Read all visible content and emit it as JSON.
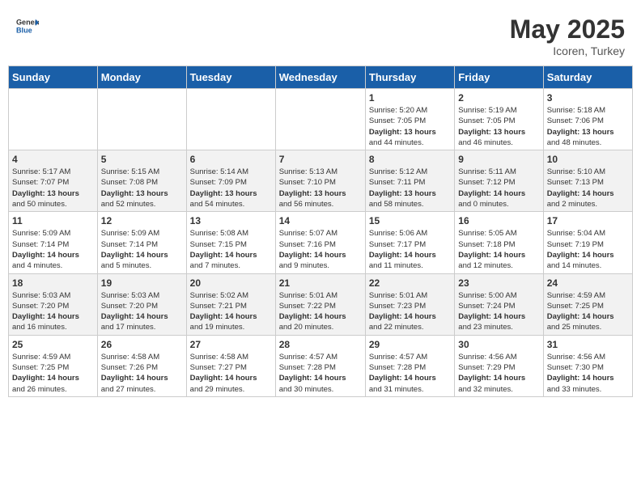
{
  "header": {
    "logo_general": "General",
    "logo_blue": "Blue",
    "month_year": "May 2025",
    "location": "Icoren, Turkey"
  },
  "weekdays": [
    "Sunday",
    "Monday",
    "Tuesday",
    "Wednesday",
    "Thursday",
    "Friday",
    "Saturday"
  ],
  "weeks": [
    [
      {
        "day": "",
        "info": ""
      },
      {
        "day": "",
        "info": ""
      },
      {
        "day": "",
        "info": ""
      },
      {
        "day": "",
        "info": ""
      },
      {
        "day": "1",
        "info": "Sunrise: 5:20 AM\nSunset: 7:05 PM\nDaylight: 13 hours\nand 44 minutes."
      },
      {
        "day": "2",
        "info": "Sunrise: 5:19 AM\nSunset: 7:05 PM\nDaylight: 13 hours\nand 46 minutes."
      },
      {
        "day": "3",
        "info": "Sunrise: 5:18 AM\nSunset: 7:06 PM\nDaylight: 13 hours\nand 48 minutes."
      }
    ],
    [
      {
        "day": "4",
        "info": "Sunrise: 5:17 AM\nSunset: 7:07 PM\nDaylight: 13 hours\nand 50 minutes."
      },
      {
        "day": "5",
        "info": "Sunrise: 5:15 AM\nSunset: 7:08 PM\nDaylight: 13 hours\nand 52 minutes."
      },
      {
        "day": "6",
        "info": "Sunrise: 5:14 AM\nSunset: 7:09 PM\nDaylight: 13 hours\nand 54 minutes."
      },
      {
        "day": "7",
        "info": "Sunrise: 5:13 AM\nSunset: 7:10 PM\nDaylight: 13 hours\nand 56 minutes."
      },
      {
        "day": "8",
        "info": "Sunrise: 5:12 AM\nSunset: 7:11 PM\nDaylight: 13 hours\nand 58 minutes."
      },
      {
        "day": "9",
        "info": "Sunrise: 5:11 AM\nSunset: 7:12 PM\nDaylight: 14 hours\nand 0 minutes."
      },
      {
        "day": "10",
        "info": "Sunrise: 5:10 AM\nSunset: 7:13 PM\nDaylight: 14 hours\nand 2 minutes."
      }
    ],
    [
      {
        "day": "11",
        "info": "Sunrise: 5:09 AM\nSunset: 7:14 PM\nDaylight: 14 hours\nand 4 minutes."
      },
      {
        "day": "12",
        "info": "Sunrise: 5:09 AM\nSunset: 7:14 PM\nDaylight: 14 hours\nand 5 minutes."
      },
      {
        "day": "13",
        "info": "Sunrise: 5:08 AM\nSunset: 7:15 PM\nDaylight: 14 hours\nand 7 minutes."
      },
      {
        "day": "14",
        "info": "Sunrise: 5:07 AM\nSunset: 7:16 PM\nDaylight: 14 hours\nand 9 minutes."
      },
      {
        "day": "15",
        "info": "Sunrise: 5:06 AM\nSunset: 7:17 PM\nDaylight: 14 hours\nand 11 minutes."
      },
      {
        "day": "16",
        "info": "Sunrise: 5:05 AM\nSunset: 7:18 PM\nDaylight: 14 hours\nand 12 minutes."
      },
      {
        "day": "17",
        "info": "Sunrise: 5:04 AM\nSunset: 7:19 PM\nDaylight: 14 hours\nand 14 minutes."
      }
    ],
    [
      {
        "day": "18",
        "info": "Sunrise: 5:03 AM\nSunset: 7:20 PM\nDaylight: 14 hours\nand 16 minutes."
      },
      {
        "day": "19",
        "info": "Sunrise: 5:03 AM\nSunset: 7:20 PM\nDaylight: 14 hours\nand 17 minutes."
      },
      {
        "day": "20",
        "info": "Sunrise: 5:02 AM\nSunset: 7:21 PM\nDaylight: 14 hours\nand 19 minutes."
      },
      {
        "day": "21",
        "info": "Sunrise: 5:01 AM\nSunset: 7:22 PM\nDaylight: 14 hours\nand 20 minutes."
      },
      {
        "day": "22",
        "info": "Sunrise: 5:01 AM\nSunset: 7:23 PM\nDaylight: 14 hours\nand 22 minutes."
      },
      {
        "day": "23",
        "info": "Sunrise: 5:00 AM\nSunset: 7:24 PM\nDaylight: 14 hours\nand 23 minutes."
      },
      {
        "day": "24",
        "info": "Sunrise: 4:59 AM\nSunset: 7:25 PM\nDaylight: 14 hours\nand 25 minutes."
      }
    ],
    [
      {
        "day": "25",
        "info": "Sunrise: 4:59 AM\nSunset: 7:25 PM\nDaylight: 14 hours\nand 26 minutes."
      },
      {
        "day": "26",
        "info": "Sunrise: 4:58 AM\nSunset: 7:26 PM\nDaylight: 14 hours\nand 27 minutes."
      },
      {
        "day": "27",
        "info": "Sunrise: 4:58 AM\nSunset: 7:27 PM\nDaylight: 14 hours\nand 29 minutes."
      },
      {
        "day": "28",
        "info": "Sunrise: 4:57 AM\nSunset: 7:28 PM\nDaylight: 14 hours\nand 30 minutes."
      },
      {
        "day": "29",
        "info": "Sunrise: 4:57 AM\nSunset: 7:28 PM\nDaylight: 14 hours\nand 31 minutes."
      },
      {
        "day": "30",
        "info": "Sunrise: 4:56 AM\nSunset: 7:29 PM\nDaylight: 14 hours\nand 32 minutes."
      },
      {
        "day": "31",
        "info": "Sunrise: 4:56 AM\nSunset: 7:30 PM\nDaylight: 14 hours\nand 33 minutes."
      }
    ]
  ]
}
